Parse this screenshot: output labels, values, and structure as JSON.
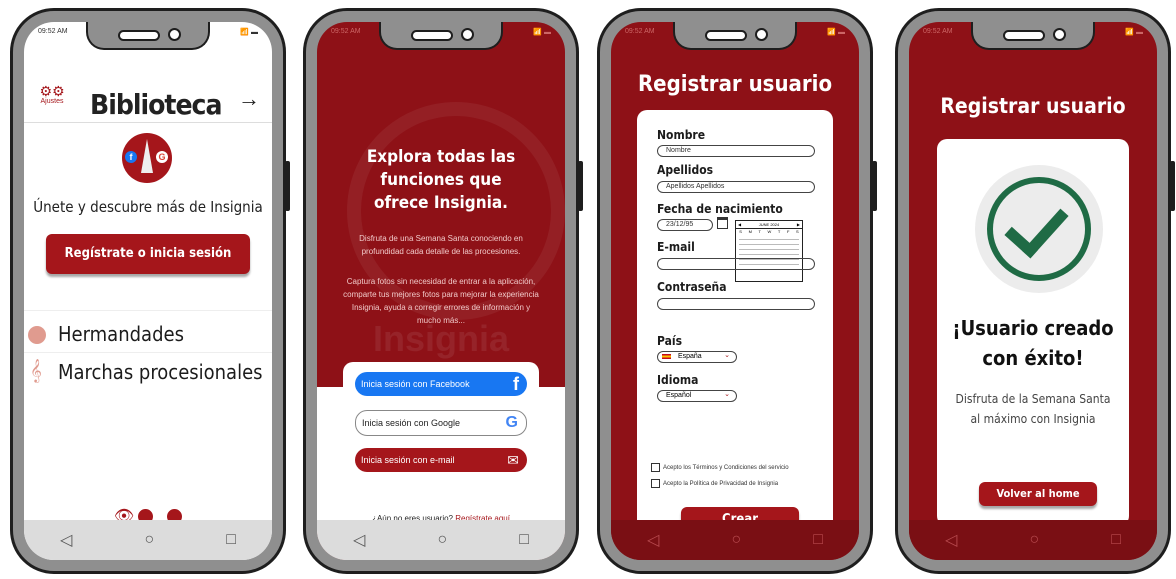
{
  "status_time": "09:52 AM",
  "nav": {
    "back": "◁",
    "home": "○",
    "recent": "□"
  },
  "screen1": {
    "settings_label": "Ajustes",
    "title": "Biblioteca",
    "arrow": "→",
    "tagline": "Únete y descubre más de Insignia",
    "cta": "Regístrate o inicia sesión",
    "menu": [
      {
        "label": "Hermandades"
      },
      {
        "label": "Marchas procesionales"
      }
    ]
  },
  "screen2": {
    "heading": "Explora todas las funciones que ofrece Insignia.",
    "para1": "Disfruta de una Semana Santa conociendo en profundidad cada detalle de las procesiones.",
    "para2": "Captura fotos sin necesidad de entrar a la aplicación, comparte tus mejores fotos para mejorar la experiencia Insignia, ayuda a corregir errores de información y mucho más...",
    "watermark": "Insignia",
    "login_facebook": "Inicia sesión con Facebook",
    "login_google": "Inicia sesión con Google",
    "login_email": "Inicia sesión con e-mail",
    "footer_question": "¿Aún no eres usuario?",
    "footer_link": "Regístrate aquí"
  },
  "screen3": {
    "title": "Registrar usuario",
    "label_nombre": "Nombre",
    "placeholder_nombre": "Nombre",
    "label_apellidos": "Apellidos",
    "placeholder_apellidos": "Apellidos Apellidos",
    "label_fecha": "Fecha de nacimiento",
    "value_fecha": "23/12/95",
    "calendar_month": "JUNE 2024",
    "calendar_days": [
      "S",
      "M",
      "T",
      "W",
      "T",
      "F",
      "S"
    ],
    "label_email": "E-mail",
    "label_password": "Contraseña",
    "label_pais": "País",
    "value_pais": "España",
    "label_idioma": "Idioma",
    "value_idioma": "Español",
    "check_terms": "Acepto los Términos y Condiciones del servicio",
    "check_privacy": "Acepto la Política de Privacidad de Insignia",
    "submit": "Crear"
  },
  "screen4": {
    "title": "Registrar usuario",
    "success": "¡Usuario creado con éxito!",
    "message": "Disfruta de la Semana Santa al máximo con Insignia",
    "button": "Volver al home"
  },
  "colors": {
    "brand": "#a5161b",
    "dark_red": "#8e1117",
    "success_green": "#1f6b45",
    "facebook": "#1877f2"
  }
}
